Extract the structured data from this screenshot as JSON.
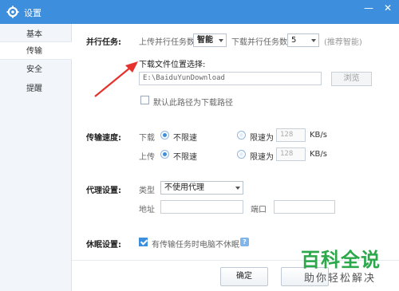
{
  "window": {
    "title": "设置",
    "minimize": "—",
    "close": "✕"
  },
  "sidebar": {
    "items": [
      {
        "label": "基本"
      },
      {
        "label": "传输"
      },
      {
        "label": "安全"
      },
      {
        "label": "提醒"
      }
    ],
    "active_index": 1
  },
  "parallel": {
    "section_label": "并行任务:",
    "upload_label": "上传并行任务数",
    "upload_value": "智能",
    "download_label": "下载并行任务数",
    "download_value": "5",
    "download_hint": "(推荐智能)"
  },
  "download_location": {
    "label": "下载文件位置选择:",
    "path": "E:\\BaiduYunDownload",
    "browse_label": "浏览",
    "default_checkbox_label": "默认此路径为下载路径",
    "default_checked": false
  },
  "speed": {
    "section_label": "传输速度:",
    "download_label": "下载",
    "upload_label": "上传",
    "unlimited_label": "不限速",
    "limit_label": "限速为",
    "download_limit_value": "128",
    "upload_limit_value": "128",
    "unit": "KB/s"
  },
  "proxy": {
    "section_label": "代理设置:",
    "type_label": "类型",
    "type_value": "不使用代理",
    "address_label": "地址",
    "port_label": "端口"
  },
  "sleep": {
    "section_label": "休眠设置:",
    "checkbox_label": "有传输任务时电脑不休眠",
    "checked": true,
    "help_glyph": "?"
  },
  "footer": {
    "ok_label": "确定"
  },
  "watermark": {
    "brand": "百科全说",
    "tagline": "助你轻松解决"
  },
  "colors": {
    "accent": "#3d8fde",
    "arrow": "#e5322d",
    "watermark_green": "#2aa84a"
  }
}
